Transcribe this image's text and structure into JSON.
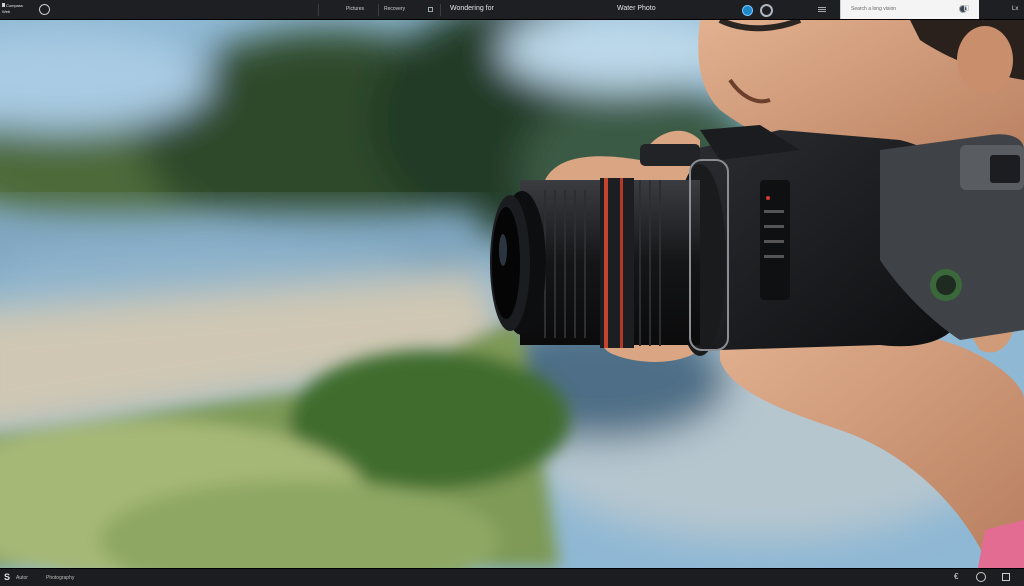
{
  "topbar": {
    "app_name_line1": "Compass",
    "app_name_line2": "Web",
    "menu_item_1": "Pictures",
    "menu_item_2": "Recovery",
    "document_title": "Wondering for",
    "panel_title": "Water Photo",
    "search_placeholder": "Search a long vision",
    "end_label": "Lx"
  },
  "bottombar": {
    "logo": "S",
    "item_1": "Autor",
    "item_2": "Photography"
  },
  "colors": {
    "bar_bg": "#1d1f22",
    "accent_blue": "#1e88c8",
    "search_bg": "#f4f4f4"
  },
  "icons": {
    "globe": "globe-icon",
    "record": "record-icon",
    "ring": "ring-icon",
    "menu": "menu-icon",
    "lock": "lock-icon"
  }
}
